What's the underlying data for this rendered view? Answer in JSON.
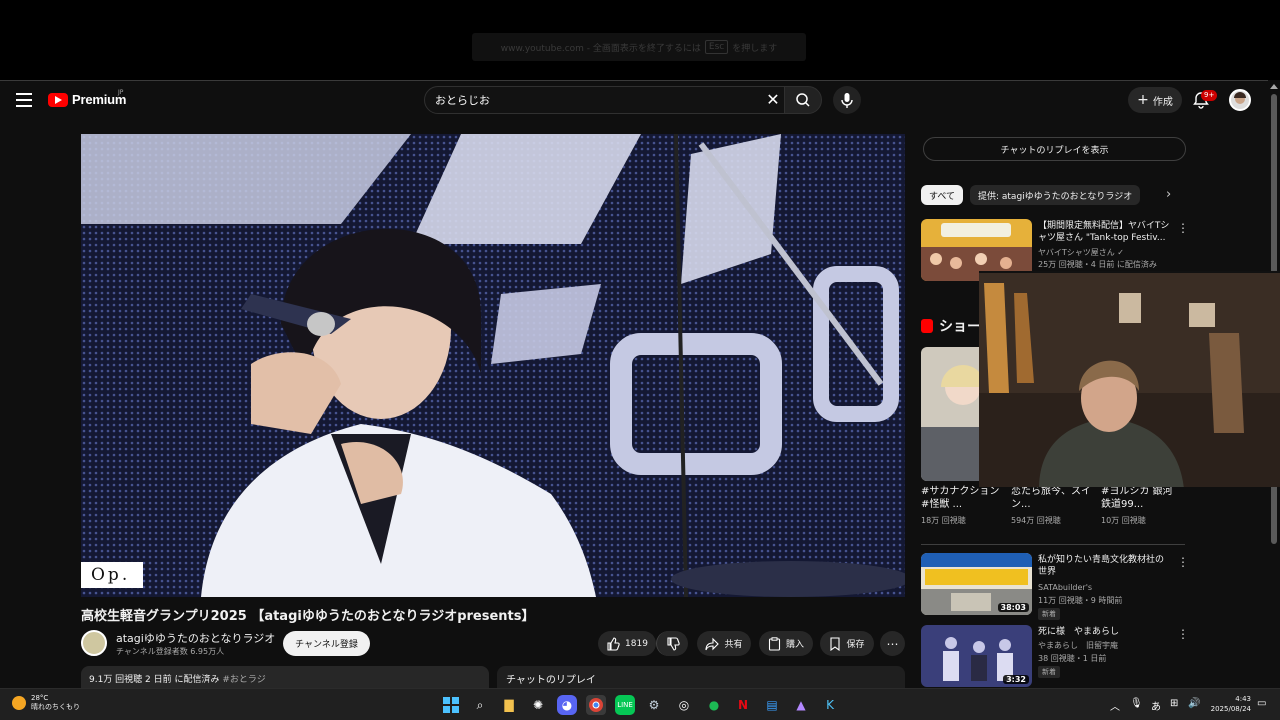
{
  "fullscreen_notice": {
    "text_before": "www.youtube.com - 全画面表示を終了するには",
    "key": "Esc",
    "text_after": "を押します"
  },
  "masthead": {
    "logo_text": "Premium",
    "logo_region": "JP",
    "search_value": "おとらじお",
    "create_label": "作成",
    "notification_badge": "9+"
  },
  "video": {
    "overlay_text": "Op.",
    "title": "高校生軽音グランプリ2025 【atagiゆゆうたのおとなりラジオpresents】",
    "channel_name": "atagiゆゆうたのおとなりラジオ",
    "subscribers": "チャンネル登録者数 6.95万人",
    "subscribe_label": "チャンネル登録",
    "like_count": "1819",
    "share_label": "共有",
    "buy_label": "購入",
    "save_label": "保存",
    "description_views": "9.1万 回視聴 2 日前 に配信済み",
    "description_tag": "#おとラジ",
    "chat_replay_label": "チャットのリプレイ"
  },
  "sidebar": {
    "show_chat_label": "チャットのリプレイを表示",
    "chips": [
      "すべて",
      "提供: atagiゆゆうたのおとなりラジオ"
    ],
    "recommendations": [
      {
        "title": "【期間限定無料配信】ヤバイTシャツ屋さん \"Tank-top Festiv...",
        "channel": "ヤバイTシャツ屋さん",
        "meta": "25万 回視聴・4 日前 に配信済み"
      },
      {
        "title": "私が知りたい青島文化教材社の世界",
        "channel": "SATAbuilder's",
        "meta": "11万 回視聴・9 時間前",
        "badge": "新着",
        "duration": "38:03"
      },
      {
        "title": "死に様　やまあらし",
        "channel": "やまあらし　旧留宇庵",
        "meta": "38 回視聴・1 日前",
        "badge": "新着",
        "duration": "3:32"
      }
    ],
    "shorts_heading": "ショート",
    "shorts": [
      {
        "title": "#サカナクション #怪獣 ...",
        "views": "18万 回視聴"
      },
      {
        "title": "恋たら旅今、スイン...",
        "views": "594万 回視聴"
      },
      {
        "title": "#ヨルシカ 銀河鉄道99...",
        "views": "10万 回視聴"
      }
    ]
  },
  "taskbar": {
    "temperature": "28°C",
    "weather": "晴れのちくもり",
    "ime": "あ",
    "time": "4:43",
    "date": "2025/08/24"
  },
  "colors": {
    "accent": "#ff0000",
    "background": "#0f0f0f",
    "chip_bg": "#272727"
  }
}
